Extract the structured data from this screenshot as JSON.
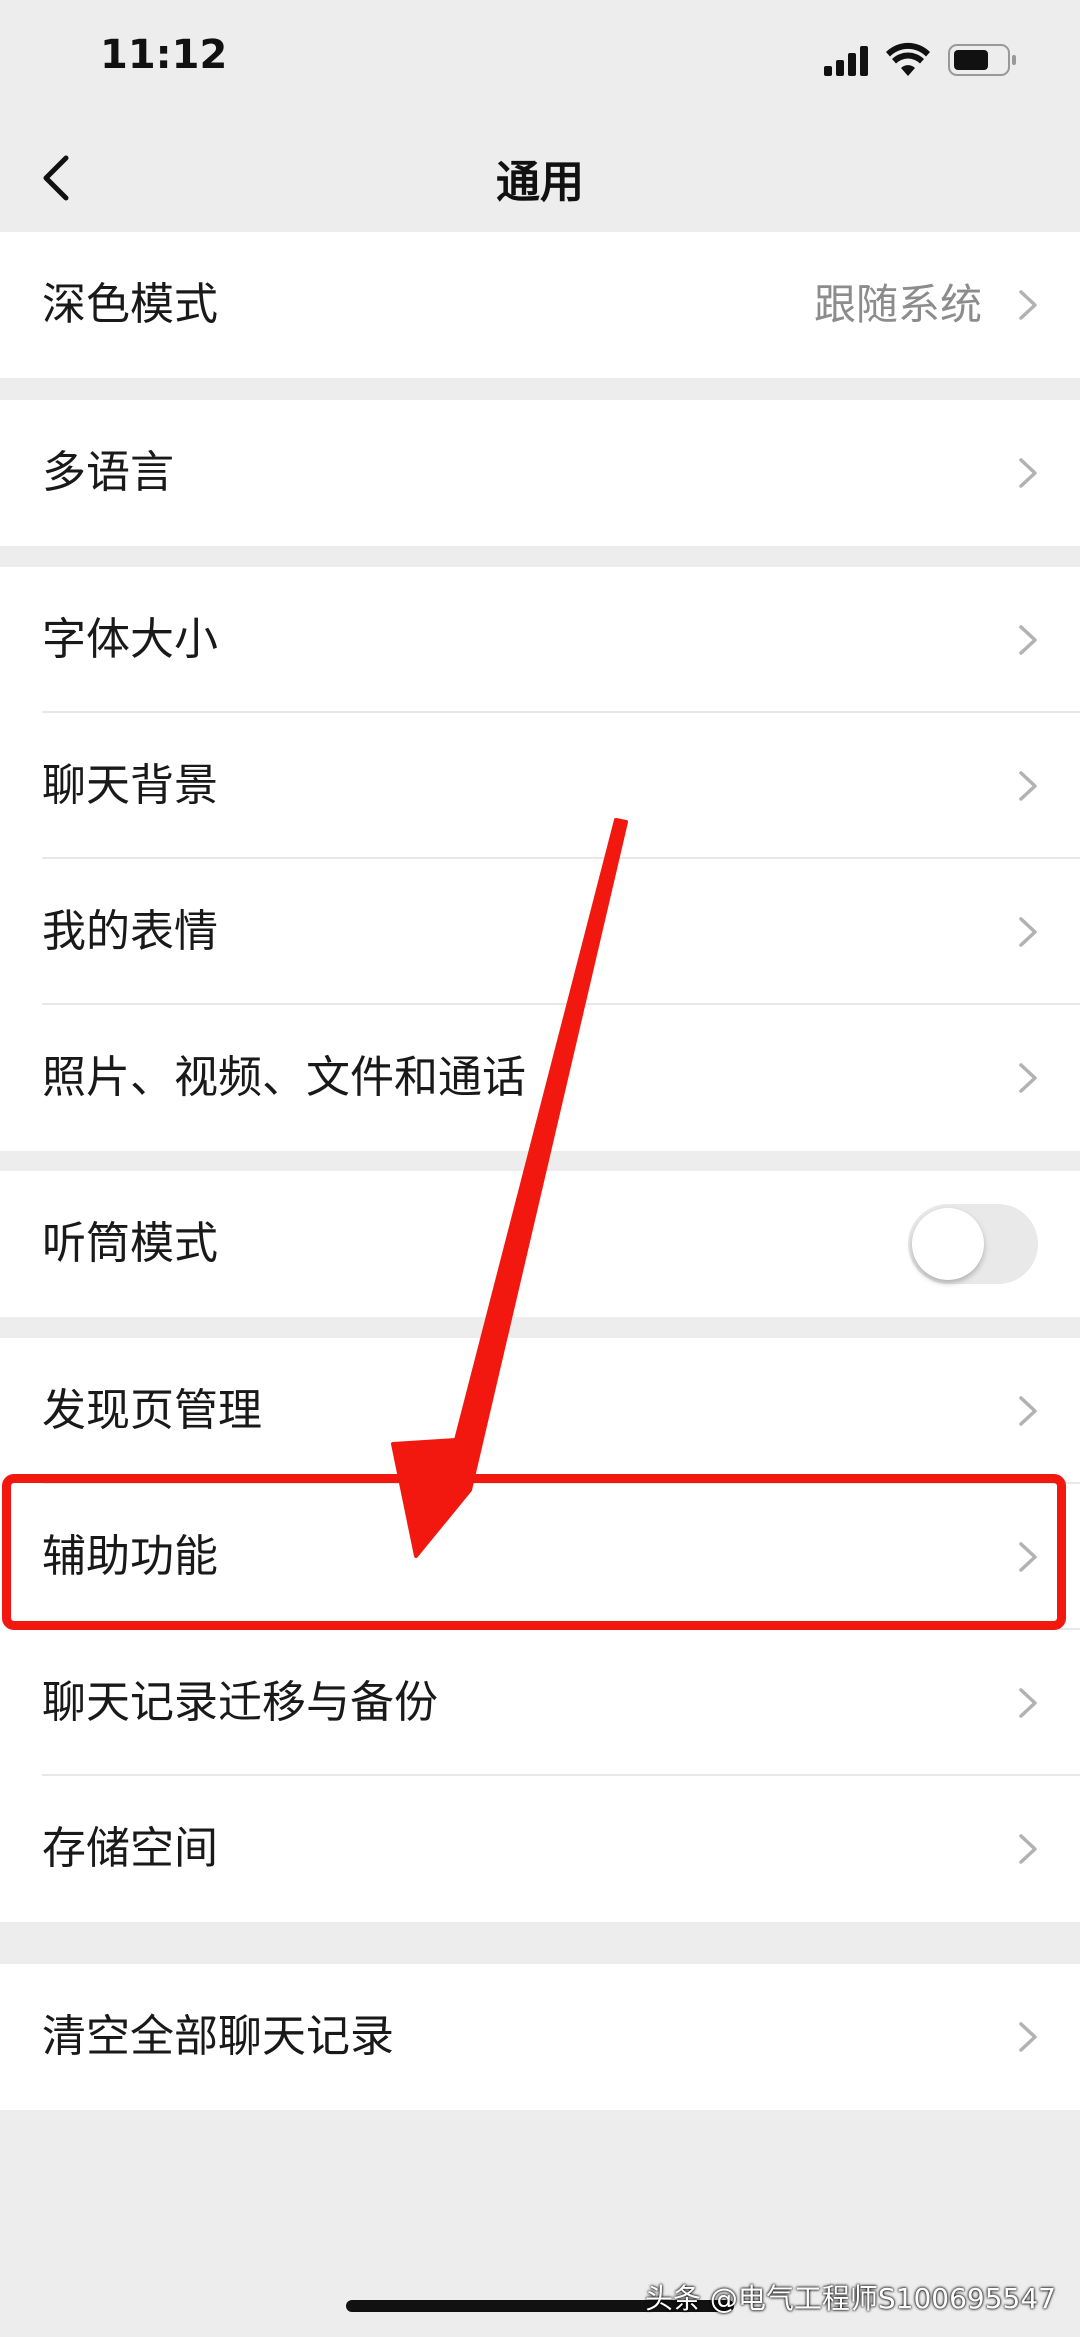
{
  "status_bar": {
    "time": "11:12"
  },
  "nav": {
    "title": "通用"
  },
  "groups": [
    {
      "items": [
        {
          "label": "深色模式",
          "value": "跟随系统"
        }
      ]
    },
    {
      "items": [
        {
          "label": "多语言"
        }
      ]
    },
    {
      "items": [
        {
          "label": "字体大小"
        },
        {
          "label": "聊天背景"
        },
        {
          "label": "我的表情"
        },
        {
          "label": "照片、视频、文件和通话"
        }
      ]
    },
    {
      "items": [
        {
          "label": "听筒模式",
          "toggle": false
        }
      ]
    },
    {
      "items": [
        {
          "label": "发现页管理"
        },
        {
          "label": "辅助功能",
          "highlighted": true
        },
        {
          "label": "聊天记录迁移与备份"
        },
        {
          "label": "存储空间"
        }
      ]
    },
    {
      "items": [
        {
          "label": "清空全部聊天记录"
        }
      ]
    }
  ],
  "annotation": {
    "color": "#f2180f"
  },
  "watermark": "头条 @电气工程师S100695547"
}
